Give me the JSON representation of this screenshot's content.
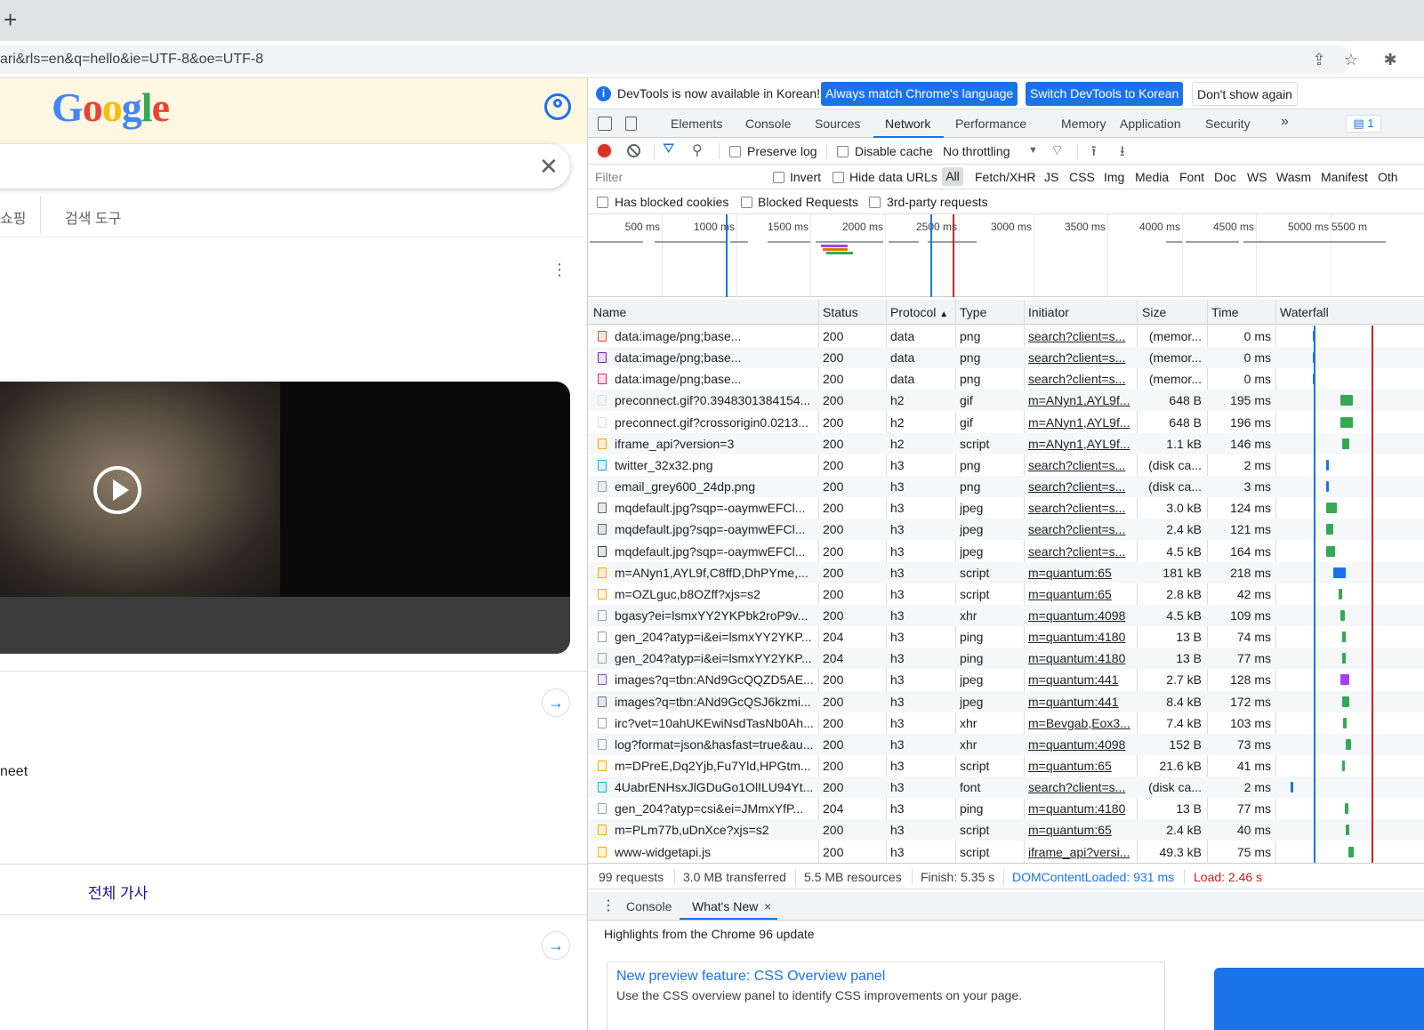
{
  "browser": {
    "new_tab_glyph": "+",
    "url": "ari&rls=en&q=hello&ie=UTF-8&oe=UTF-8",
    "icons": [
      "share-icon",
      "bookmark-star-icon",
      "extensions-icon"
    ]
  },
  "google": {
    "logo_letters": [
      "G",
      "o",
      "o",
      "g",
      "l",
      "e"
    ],
    "clear_glyph": "✕",
    "tabs": [
      "쇼핑",
      "검색 도구"
    ],
    "more_glyph": "⋮",
    "neet_text": "neet",
    "more_link": "전체 가사",
    "arrow_glyph": "→"
  },
  "devtools": {
    "infobar": {
      "text": "DevTools is now available in Korean!",
      "btn_match": "Always match Chrome's language",
      "btn_switch": "Switch DevTools to Korean",
      "btn_dismiss": "Don't show again"
    },
    "tabs": [
      "Elements",
      "Console",
      "Sources",
      "Network",
      "Performance",
      "Memory",
      "Application",
      "Security"
    ],
    "more_tabs_glyph": "»",
    "issues_badge": "1",
    "toolbar": {
      "preserve_log": "Preserve log",
      "disable_cache": "Disable cache",
      "throttling": "No throttling"
    },
    "filter": {
      "placeholder": "Filter",
      "invert": "Invert",
      "hide_data_urls": "Hide data URLs",
      "all": "All",
      "types": [
        "Fetch/XHR",
        "JS",
        "CSS",
        "Img",
        "Media",
        "Font",
        "Doc",
        "WS",
        "Wasm",
        "Manifest",
        "Oth"
      ],
      "has_blocked_cookies": "Has blocked cookies",
      "blocked_requests": "Blocked Requests",
      "third_party": "3rd-party requests"
    },
    "overview_ticks": [
      "500 ms",
      "1000 ms",
      "1500 ms",
      "2000 ms",
      "2500 ms",
      "3000 ms",
      "3500 ms",
      "4000 ms",
      "4500 ms",
      "5000 ms",
      "5500 m"
    ],
    "columns": {
      "name": "Name",
      "status": "Status",
      "protocol": "Protocol",
      "sort_glyph": "▲",
      "type": "Type",
      "initiator": "Initiator",
      "size": "Size",
      "time": "Time",
      "waterfall": "Waterfall"
    },
    "rows": [
      {
        "name": "data:image/png;base...",
        "status": "200",
        "protocol": "data",
        "type": "png",
        "initiator": "search?client=s...",
        "size": "(memor...",
        "time": "0 ms",
        "icon": "#ea4335"
      },
      {
        "name": "data:image/png;base...",
        "status": "200",
        "protocol": "data",
        "type": "png",
        "initiator": "search?client=s...",
        "size": "(memor...",
        "time": "0 ms",
        "icon": "#7b1fa2"
      },
      {
        "name": "data:image/png;base...",
        "status": "200",
        "protocol": "data",
        "type": "png",
        "initiator": "search?client=s...",
        "size": "(memor...",
        "time": "0 ms",
        "icon": "#e91e63"
      },
      {
        "name": "preconnect.gif?0.3948301384154...",
        "status": "200",
        "protocol": "h2",
        "type": "gif",
        "initiator": "m=ANyn1,AYL9f...",
        "size": "648 B",
        "time": "195 ms",
        "icon": "#e0e0e0"
      },
      {
        "name": "preconnect.gif?crossorigin0.0213...",
        "status": "200",
        "protocol": "h2",
        "type": "gif",
        "initiator": "m=ANyn1,AYL9f...",
        "size": "648 B",
        "time": "196 ms",
        "icon": "#e0e0e0"
      },
      {
        "name": "iframe_api?version=3",
        "status": "200",
        "protocol": "h2",
        "type": "script",
        "initiator": "m=ANyn1,AYL9f...",
        "size": "1.1 kB",
        "time": "146 ms",
        "icon": "#f9ab00"
      },
      {
        "name": "twitter_32x32.png",
        "status": "200",
        "protocol": "h3",
        "type": "png",
        "initiator": "search?client=s...",
        "size": "(disk ca...",
        "time": "2 ms",
        "icon": "#1da1f2"
      },
      {
        "name": "email_grey600_24dp.png",
        "status": "200",
        "protocol": "h3",
        "type": "png",
        "initiator": "search?client=s...",
        "size": "(disk ca...",
        "time": "3 ms",
        "icon": "#9e9e9e"
      },
      {
        "name": "mqdefault.jpg?sqp=-oaymwEFCl...",
        "status": "200",
        "protocol": "h3",
        "type": "jpeg",
        "initiator": "search?client=s...",
        "size": "3.0 kB",
        "time": "124 ms",
        "icon": "#5f6368"
      },
      {
        "name": "mqdefault.jpg?sqp=-oaymwEFCl...",
        "status": "200",
        "protocol": "h3",
        "type": "jpeg",
        "initiator": "search?client=s...",
        "size": "2.4 kB",
        "time": "121 ms",
        "icon": "#5f6368"
      },
      {
        "name": "mqdefault.jpg?sqp=-oaymwEFCl...",
        "status": "200",
        "protocol": "h3",
        "type": "jpeg",
        "initiator": "search?client=s...",
        "size": "4.5 kB",
        "time": "164 ms",
        "icon": "#3c4043"
      },
      {
        "name": "m=ANyn1,AYL9f,C8ffD,DhPYme,...",
        "status": "200",
        "protocol": "h3",
        "type": "script",
        "initiator": "m=quantum:65",
        "size": "181 kB",
        "time": "218 ms",
        "icon": "#f9ab00"
      },
      {
        "name": "m=OZLguc,b8OZff?xjs=s2",
        "status": "200",
        "protocol": "h3",
        "type": "script",
        "initiator": "m=quantum:65",
        "size": "2.8 kB",
        "time": "42 ms",
        "icon": "#f9ab00"
      },
      {
        "name": "bgasy?ei=lsmxYY2YKPbk2roP9v...",
        "status": "200",
        "protocol": "h3",
        "type": "xhr",
        "initiator": "m=quantum:4098",
        "size": "4.5 kB",
        "time": "109 ms",
        "icon": "#ffffff"
      },
      {
        "name": "gen_204?atyp=i&ei=lsmxYY2YKP...",
        "status": "204",
        "protocol": "h3",
        "type": "ping",
        "initiator": "m=quantum:4180",
        "size": "13 B",
        "time": "74 ms",
        "icon": "#ffffff"
      },
      {
        "name": "gen_204?atyp=i&ei=lsmxYY2YKP...",
        "status": "204",
        "protocol": "h3",
        "type": "ping",
        "initiator": "m=quantum:4180",
        "size": "13 B",
        "time": "77 ms",
        "icon": "#ffffff"
      },
      {
        "name": "images?q=tbn:ANd9GcQQZD5AE...",
        "status": "200",
        "protocol": "h3",
        "type": "jpeg",
        "initiator": "m=quantum:441",
        "size": "2.7 kB",
        "time": "128 ms",
        "icon": "#7e57c2"
      },
      {
        "name": "images?q=tbn:ANd9GcQSJ6kzmi...",
        "status": "200",
        "protocol": "h3",
        "type": "jpeg",
        "initiator": "m=quantum:441",
        "size": "8.4 kB",
        "time": "172 ms",
        "icon": "#607d8b"
      },
      {
        "name": "irc?vet=10ahUKEwiNsdTasNb0Ah...",
        "status": "200",
        "protocol": "h3",
        "type": "xhr",
        "initiator": "m=Bevgab,Eox3...",
        "size": "7.4 kB",
        "time": "103 ms",
        "icon": "#ffffff"
      },
      {
        "name": "log?format=json&hasfast=true&au...",
        "status": "200",
        "protocol": "h3",
        "type": "xhr",
        "initiator": "m=quantum:4098",
        "size": "152 B",
        "time": "73 ms",
        "icon": "#ffffff"
      },
      {
        "name": "m=DPreE,Dq2Yjb,Fu7Yld,HPGtm...",
        "status": "200",
        "protocol": "h3",
        "type": "script",
        "initiator": "m=quantum:65",
        "size": "21.6 kB",
        "time": "41 ms",
        "icon": "#f9ab00"
      },
      {
        "name": "4UabrENHsxJlGDuGo1OlILU94Yt...",
        "status": "200",
        "protocol": "h3",
        "type": "font",
        "initiator": "search?client=s...",
        "size": "(disk ca...",
        "time": "2 ms",
        "icon": "#12b5cb"
      },
      {
        "name": "gen_204?atyp=csi&ei=JMmxYfP...",
        "status": "204",
        "protocol": "h3",
        "type": "ping",
        "initiator": "m=quantum:4180",
        "size": "13 B",
        "time": "77 ms",
        "icon": "#ffffff"
      },
      {
        "name": "m=PLm77b,uDnXce?xjs=s2",
        "status": "200",
        "protocol": "h3",
        "type": "script",
        "initiator": "m=quantum:65",
        "size": "2.4 kB",
        "time": "40 ms",
        "icon": "#f9ab00"
      },
      {
        "name": "www-widgetapi.js",
        "status": "200",
        "protocol": "h3",
        "type": "script",
        "initiator": "iframe_api?versi...",
        "size": "49.3 kB",
        "time": "75 ms",
        "icon": "#f9ab00"
      }
    ],
    "summary": {
      "requests": "99 requests",
      "transferred": "3.0 MB transferred",
      "resources": "5.5 MB resources",
      "finish": "Finish: 5.35 s",
      "dcl": "DOMContentLoaded: 931 ms",
      "load": "Load: 2.46 s"
    },
    "drawer": {
      "tabs": [
        "Console",
        "What's New"
      ],
      "close_glyph": "×",
      "headline": "Highlights from the Chrome 96 update",
      "card_title": "New preview feature: CSS Overview panel",
      "card_text": "Use the CSS overview panel to identify CSS improvements on your page."
    },
    "colors": {
      "accent": "#1a73e8",
      "dcl": "#1a73e8",
      "load": "#c5221f",
      "record": "#d93025"
    }
  }
}
